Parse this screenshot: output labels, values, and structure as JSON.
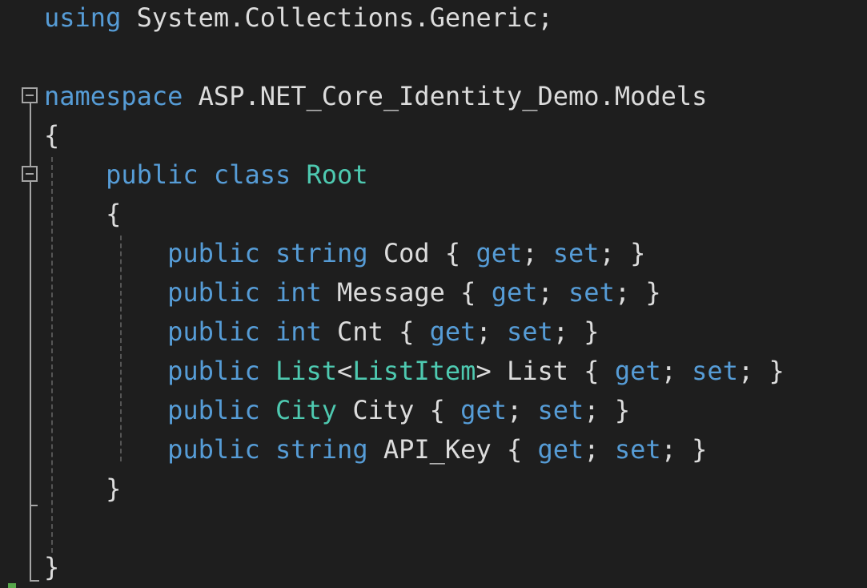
{
  "code_lines": [
    [
      {
        "cls": "k",
        "text": "using"
      },
      {
        "cls": "p",
        "text": " System.Collections.Generic;"
      }
    ],
    [],
    [
      {
        "cls": "k",
        "text": "namespace"
      },
      {
        "cls": "p",
        "text": " ASP.NET_Core_Identity_Demo.Models"
      }
    ],
    [
      {
        "cls": "p",
        "text": "{"
      }
    ],
    [
      {
        "cls": "p",
        "text": "    "
      },
      {
        "cls": "k",
        "text": "public"
      },
      {
        "cls": "p",
        "text": " "
      },
      {
        "cls": "k",
        "text": "class"
      },
      {
        "cls": "p",
        "text": " "
      },
      {
        "cls": "t",
        "text": "Root"
      }
    ],
    [
      {
        "cls": "p",
        "text": "    {"
      }
    ],
    [
      {
        "cls": "p",
        "text": "        "
      },
      {
        "cls": "k",
        "text": "public"
      },
      {
        "cls": "p",
        "text": " "
      },
      {
        "cls": "k",
        "text": "string"
      },
      {
        "cls": "p",
        "text": " Cod { "
      },
      {
        "cls": "k",
        "text": "get"
      },
      {
        "cls": "p",
        "text": "; "
      },
      {
        "cls": "k",
        "text": "set"
      },
      {
        "cls": "p",
        "text": "; }"
      }
    ],
    [
      {
        "cls": "p",
        "text": "        "
      },
      {
        "cls": "k",
        "text": "public"
      },
      {
        "cls": "p",
        "text": " "
      },
      {
        "cls": "k",
        "text": "int"
      },
      {
        "cls": "p",
        "text": " Message { "
      },
      {
        "cls": "k",
        "text": "get"
      },
      {
        "cls": "p",
        "text": "; "
      },
      {
        "cls": "k",
        "text": "set"
      },
      {
        "cls": "p",
        "text": "; }"
      }
    ],
    [
      {
        "cls": "p",
        "text": "        "
      },
      {
        "cls": "k",
        "text": "public"
      },
      {
        "cls": "p",
        "text": " "
      },
      {
        "cls": "k",
        "text": "int"
      },
      {
        "cls": "p",
        "text": " Cnt { "
      },
      {
        "cls": "k",
        "text": "get"
      },
      {
        "cls": "p",
        "text": "; "
      },
      {
        "cls": "k",
        "text": "set"
      },
      {
        "cls": "p",
        "text": "; }"
      }
    ],
    [
      {
        "cls": "p",
        "text": "        "
      },
      {
        "cls": "k",
        "text": "public"
      },
      {
        "cls": "p",
        "text": " "
      },
      {
        "cls": "t",
        "text": "List"
      },
      {
        "cls": "p",
        "text": "<"
      },
      {
        "cls": "t",
        "text": "ListItem"
      },
      {
        "cls": "p",
        "text": "> List { "
      },
      {
        "cls": "k",
        "text": "get"
      },
      {
        "cls": "p",
        "text": "; "
      },
      {
        "cls": "k",
        "text": "set"
      },
      {
        "cls": "p",
        "text": "; }"
      }
    ],
    [
      {
        "cls": "p",
        "text": "        "
      },
      {
        "cls": "k",
        "text": "public"
      },
      {
        "cls": "p",
        "text": " "
      },
      {
        "cls": "t",
        "text": "City"
      },
      {
        "cls": "p",
        "text": " City { "
      },
      {
        "cls": "k",
        "text": "get"
      },
      {
        "cls": "p",
        "text": "; "
      },
      {
        "cls": "k",
        "text": "set"
      },
      {
        "cls": "p",
        "text": "; }"
      }
    ],
    [
      {
        "cls": "p",
        "text": "        "
      },
      {
        "cls": "k",
        "text": "public"
      },
      {
        "cls": "p",
        "text": " "
      },
      {
        "cls": "k",
        "text": "string"
      },
      {
        "cls": "p",
        "text": " API_Key { "
      },
      {
        "cls": "k",
        "text": "get"
      },
      {
        "cls": "p",
        "text": "; "
      },
      {
        "cls": "k",
        "text": "set"
      },
      {
        "cls": "p",
        "text": "; }"
      }
    ],
    [
      {
        "cls": "p",
        "text": "    }"
      }
    ],
    [],
    [
      {
        "cls": "p",
        "text": "}"
      }
    ]
  ],
  "colors": {
    "background": "#1e1e1e",
    "keyword": "#569cd6",
    "type": "#4ec9b0",
    "plain": "#dcdcdc"
  }
}
